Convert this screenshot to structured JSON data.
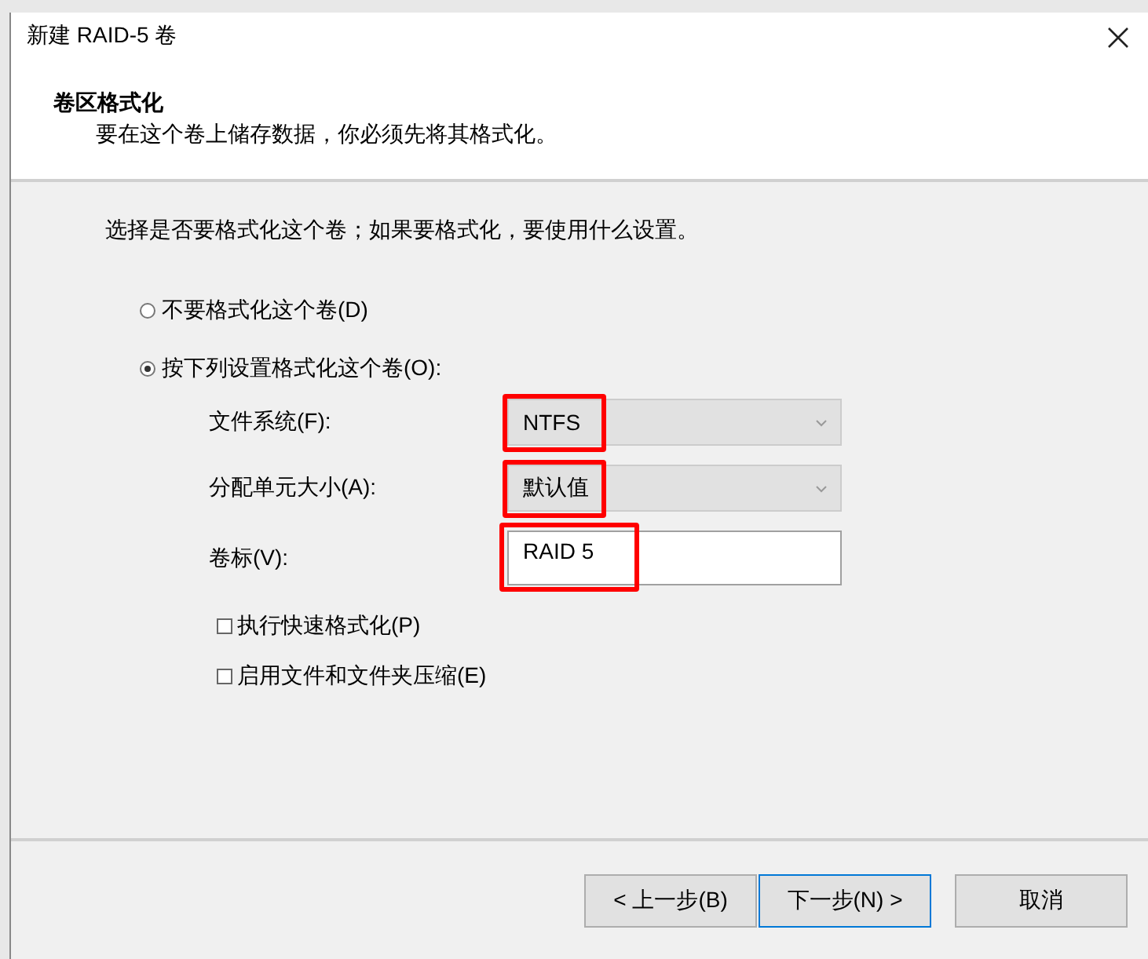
{
  "window": {
    "title": "新建 RAID-5 卷"
  },
  "header": {
    "title": "卷区格式化",
    "subtitle": "要在这个卷上储存数据，你必须先将其格式化。"
  },
  "instruction": "选择是否要格式化这个卷；如果要格式化，要使用什么设置。",
  "options": [
    {
      "label": "不要格式化这个卷(D)",
      "selected": false
    },
    {
      "label": "按下列设置格式化这个卷(O):",
      "selected": true
    }
  ],
  "fields": [
    {
      "kind": "dropdown",
      "label": "文件系统(F):",
      "value": "NTFS",
      "highlighted": true
    },
    {
      "kind": "dropdown",
      "label": "分配单元大小(A):",
      "value": "默认值",
      "highlighted": true
    },
    {
      "kind": "text",
      "label": "卷标(V):",
      "value": "RAID 5",
      "highlighted": true
    }
  ],
  "checkboxes": [
    {
      "label": "执行快速格式化(P)",
      "checked": false
    },
    {
      "label": "启用文件和文件夹压缩(E)",
      "checked": false
    }
  ],
  "buttons": [
    {
      "label": "< 上一步(B)",
      "kind": "normal"
    },
    {
      "label": "下一步(N) >",
      "kind": "default"
    },
    {
      "label": "取消",
      "kind": "cancel"
    }
  ]
}
